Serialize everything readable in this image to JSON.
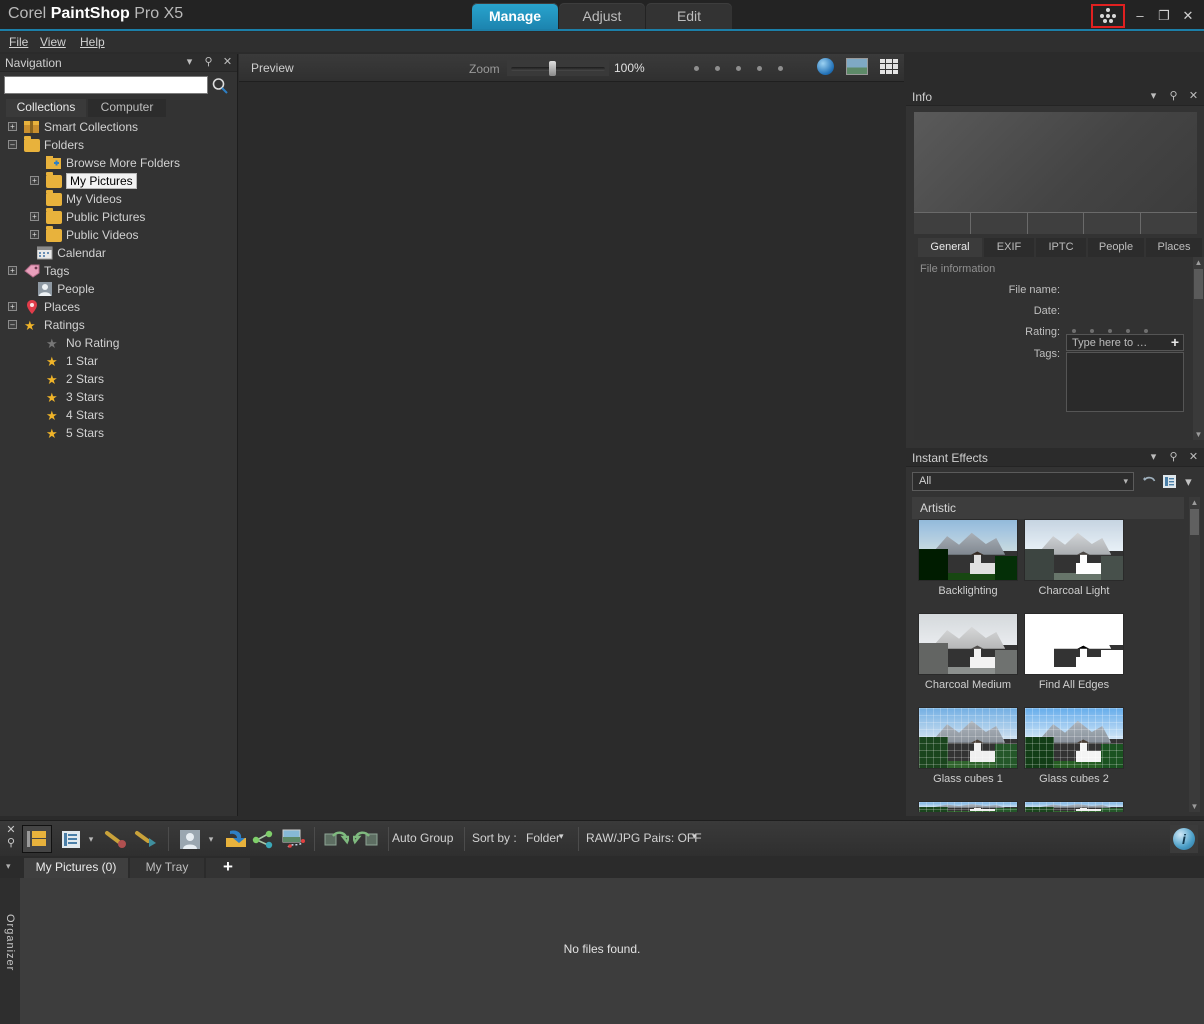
{
  "window": {
    "title_prefix": "Corel ",
    "title_bold": "PaintShop",
    "title_suffix": " Pro X5",
    "minimize_label": "–",
    "restore_label": "❐",
    "close_label": "✕",
    "highlighted_icon_name": "cluster-icon",
    "accent_color": "#1c7fa8",
    "highlight_color": "#e02020"
  },
  "mode_tabs": [
    {
      "label": "Manage",
      "active": true
    },
    {
      "label": "Adjust",
      "active": false
    },
    {
      "label": "Edit",
      "active": false
    }
  ],
  "menu": [
    {
      "label": "File",
      "mnemonic": "F"
    },
    {
      "label": "View",
      "mnemonic": "V"
    },
    {
      "label": "Help",
      "mnemonic": "H"
    }
  ],
  "navigation": {
    "title": "Navigation",
    "caret": "▾",
    "pin": "⚲",
    "close": "✕",
    "search_value": "",
    "search_placeholder": "",
    "tabs": [
      {
        "label": "Collections",
        "active": true
      },
      {
        "label": "Computer",
        "active": false
      }
    ],
    "tree": [
      {
        "label": "Smart Collections",
        "indent": 0,
        "expander": "+",
        "icon": "smart-collection-icon",
        "selected": false
      },
      {
        "label": "Folders",
        "indent": 0,
        "expander": "–",
        "icon": "folder-icon",
        "selected": false
      },
      {
        "label": "Browse More Folders",
        "indent": 1,
        "expander": "",
        "icon": "folder-add-icon",
        "selected": false
      },
      {
        "label": "My Pictures",
        "indent": 1,
        "expander": "+",
        "icon": "folder-icon",
        "selected": true
      },
      {
        "label": "My Videos",
        "indent": 1,
        "expander": "",
        "icon": "folder-icon",
        "selected": false
      },
      {
        "label": "Public Pictures",
        "indent": 1,
        "expander": "+",
        "icon": "folder-icon",
        "selected": false
      },
      {
        "label": "Public Videos",
        "indent": 1,
        "expander": "+",
        "icon": "folder-icon",
        "selected": false
      },
      {
        "label": "Calendar",
        "indent": 0.6,
        "expander": "",
        "icon": "calendar-icon",
        "selected": false
      },
      {
        "label": "Tags",
        "indent": 0,
        "expander": "+",
        "icon": "tag-icon",
        "selected": false
      },
      {
        "label": "People",
        "indent": 0.6,
        "expander": "",
        "icon": "people-icon",
        "selected": false
      },
      {
        "label": "Places",
        "indent": 0,
        "expander": "+",
        "icon": "place-pin-icon",
        "selected": false
      },
      {
        "label": "Ratings",
        "indent": 0,
        "expander": "–",
        "icon": "star-icon",
        "selected": false
      },
      {
        "label": "No Rating",
        "indent": 1,
        "expander": "",
        "icon": "star-gray-icon",
        "selected": false
      },
      {
        "label": "1 Star",
        "indent": 1,
        "expander": "",
        "icon": "star-icon",
        "selected": false
      },
      {
        "label": "2 Stars",
        "indent": 1,
        "expander": "",
        "icon": "star-icon",
        "selected": false
      },
      {
        "label": "3 Stars",
        "indent": 1,
        "expander": "",
        "icon": "star-icon",
        "selected": false
      },
      {
        "label": "4 Stars",
        "indent": 1,
        "expander": "",
        "icon": "star-icon",
        "selected": false
      },
      {
        "label": "5 Stars",
        "indent": 1,
        "expander": "",
        "icon": "star-icon",
        "selected": false
      }
    ]
  },
  "preview": {
    "label": "Preview",
    "zoom_label": "Zoom",
    "zoom_value": "100%",
    "rating_dots": 5,
    "icons": [
      "globe-icon",
      "photo-icon",
      "grid-icon"
    ]
  },
  "info": {
    "title": "Info",
    "caret": "▾",
    "pin": "⚲",
    "close": "✕",
    "tabs": [
      {
        "label": "General",
        "active": true
      },
      {
        "label": "EXIF",
        "active": false
      },
      {
        "label": "IPTC",
        "active": false
      },
      {
        "label": "People",
        "active": false
      },
      {
        "label": "Places",
        "active": false
      }
    ],
    "section_label": "File information",
    "fields": [
      {
        "label": "File name:",
        "value": ""
      },
      {
        "label": "Date:",
        "value": ""
      },
      {
        "label": "Rating:",
        "value": ""
      },
      {
        "label": "Tags:",
        "value": ""
      }
    ],
    "tags_placeholder": "Type here to …",
    "tags_add_label": "+"
  },
  "instant_effects": {
    "title": "Instant Effects",
    "caret": "▾",
    "pin": "⚲",
    "close": "✕",
    "filter_value": "All",
    "filter_caret": "▾",
    "reset_icon": "undo-icon",
    "list_icon": "list-view-icon",
    "menu_caret": "▾",
    "group_label": "Artistic",
    "effects": [
      {
        "label": "Backlighting",
        "style": "backlighting"
      },
      {
        "label": "Charcoal Light",
        "style": "charcoal-light"
      },
      {
        "label": "Charcoal Medium",
        "style": "charcoal-medium"
      },
      {
        "label": "Find All Edges",
        "style": "find-all-edges"
      },
      {
        "label": "Glass cubes 1",
        "style": "glass-cubes-1"
      },
      {
        "label": "Glass cubes 2",
        "style": "glass-cubes-2"
      }
    ]
  },
  "bottom_toolbar": {
    "buttons": [
      {
        "name": "show-folders-button",
        "icon": "folders-icon",
        "active": true
      },
      {
        "name": "view-mode-button",
        "icon": "list-view-icon",
        "active": false
      },
      {
        "name": "quick-fix-button",
        "icon": "wand-icon",
        "active": false
      },
      {
        "name": "apply-fix-button",
        "icon": "wand-play-icon",
        "active": false
      },
      {
        "name": "people-tag-button",
        "icon": "person-icon",
        "active": false
      },
      {
        "name": "import-button",
        "icon": "import-icon",
        "active": false
      },
      {
        "name": "share-button",
        "icon": "share-icon",
        "active": false
      },
      {
        "name": "map-photo-button",
        "icon": "map-photo-icon",
        "active": false
      },
      {
        "name": "rotate-left-button",
        "icon": "rotate-left-icon",
        "active": false
      },
      {
        "name": "rotate-right-button",
        "icon": "rotate-right-icon",
        "active": false
      }
    ],
    "auto_group_label": "Auto Group",
    "sort_by_label": "Sort by :",
    "sort_value": "Folder",
    "sort_caret": "▾",
    "raw_jpg_label": "RAW/JPG Pairs: OFF",
    "raw_jpg_caret": "▾",
    "info_button_label": "i"
  },
  "tray": {
    "caret": "▾",
    "tabs": [
      {
        "label": "My Pictures (0)",
        "active": true
      },
      {
        "label": "My Tray",
        "active": false
      }
    ],
    "add_label": "+"
  },
  "file_area": {
    "empty_message": "No files found.",
    "organizer_label": "Organizer"
  }
}
